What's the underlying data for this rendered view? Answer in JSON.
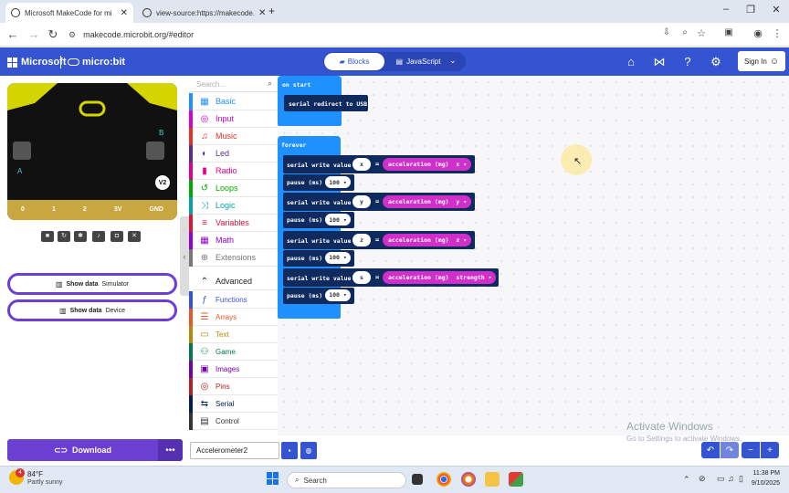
{
  "browser": {
    "tabs": [
      {
        "title": "Microsoft MakeCode for mi",
        "close": "✕"
      },
      {
        "title": "view-source:https://makecode.",
        "close": "✕"
      }
    ],
    "new_tab": "+",
    "url": "makecode.microbit.org/#editor"
  },
  "header": {
    "brand": "Microsoft",
    "product": "micro:bit",
    "toggle_blocks": "Blocks",
    "toggle_js": "JavaScript",
    "sign_in": "Sign In"
  },
  "simulator": {
    "board_label": "V2",
    "pins": [
      "0",
      "1",
      "2",
      "3V",
      "GND"
    ],
    "buttons": {
      "a": "A",
      "b": "B"
    },
    "show_data_simulator": {
      "label": "Show data",
      "sub": "Simulator"
    },
    "show_data_device": {
      "label": "Show data",
      "sub": "Device"
    }
  },
  "toolbox": {
    "search_placeholder": "Search...",
    "categories": [
      {
        "label": "Basic",
        "color": "#1e90ff"
      },
      {
        "label": "Input",
        "color": "#d400d4"
      },
      {
        "label": "Music",
        "color": "#e63022"
      },
      {
        "label": "Led",
        "color": "#5c2d91"
      },
      {
        "label": "Radio",
        "color": "#e3008c"
      },
      {
        "label": "Loops",
        "color": "#00aa00"
      },
      {
        "label": "Logic",
        "color": "#00a4a6"
      },
      {
        "label": "Variables",
        "color": "#dc143c"
      },
      {
        "label": "Math",
        "color": "#9400d3"
      },
      {
        "label": "Extensions",
        "color": "#777777"
      }
    ],
    "advanced": "Advanced",
    "advanced_categories": [
      {
        "label": "Functions",
        "color": "#3455db"
      },
      {
        "label": "Arrays",
        "color": "#e65722"
      },
      {
        "label": "Text",
        "color": "#b8860b"
      },
      {
        "label": "Game",
        "color": "#007a4b"
      },
      {
        "label": "Images",
        "color": "#7600a8"
      },
      {
        "label": "Pins",
        "color": "#b22222"
      },
      {
        "label": "Serial",
        "color": "#002050"
      },
      {
        "label": "Control",
        "color": "#333333"
      }
    ]
  },
  "workspace": {
    "on_start": "on start",
    "serial_redirect": "serial redirect to USB",
    "forever": "forever",
    "serial_write": "serial write value",
    "eq": "=",
    "accel": "acceleration (mg)",
    "pause": "pause (ms)",
    "pause_value": "100",
    "rows": [
      {
        "name": "x",
        "axis": "x"
      },
      {
        "name": "y",
        "axis": "y"
      },
      {
        "name": "z",
        "axis": "z"
      },
      {
        "name": "s",
        "axis": "strength"
      }
    ]
  },
  "bottom": {
    "download": "Download",
    "more": "•••",
    "project_name": "Accelerometer2",
    "activate_title": "Activate Windows",
    "activate_sub": "Go to Settings to activate Windows."
  },
  "taskbar": {
    "weather_temp": "84°F",
    "weather_desc": "Partly sunny",
    "weather_badge": "4",
    "search": "Search",
    "time": "11:38 PM",
    "date": "9/10/2025"
  }
}
